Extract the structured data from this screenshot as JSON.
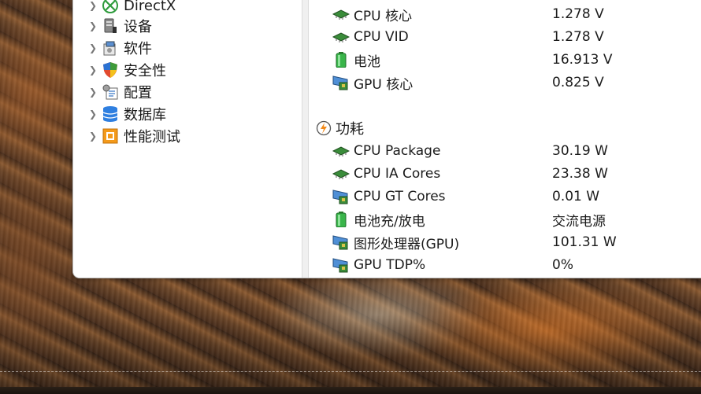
{
  "tree": {
    "items": [
      {
        "label": "DirectX",
        "icon": "xbox-icon"
      },
      {
        "label": "设备",
        "icon": "device-icon"
      },
      {
        "label": "软件",
        "icon": "software-icon"
      },
      {
        "label": "安全性",
        "icon": "security-shield-icon"
      },
      {
        "label": "配置",
        "icon": "config-icon"
      },
      {
        "label": "数据库",
        "icon": "database-icon"
      },
      {
        "label": "性能测试",
        "icon": "benchmark-icon"
      }
    ]
  },
  "voltage": {
    "rows": [
      {
        "label": "CPU 核心",
        "value": "1.278 V",
        "icon": "cpu-chip-icon"
      },
      {
        "label": "CPU VID",
        "value": "1.278 V",
        "icon": "cpu-chip-icon"
      },
      {
        "label": "电池",
        "value": "16.913 V",
        "icon": "battery-icon"
      },
      {
        "label": "GPU 核心",
        "value": "0.825 V",
        "icon": "gpu-card-icon"
      }
    ]
  },
  "power": {
    "title": "功耗",
    "icon": "power-icon",
    "rows": [
      {
        "label": "CPU Package",
        "value": "30.19 W",
        "icon": "cpu-chip-icon"
      },
      {
        "label": "CPU IA Cores",
        "value": "23.38 W",
        "icon": "cpu-chip-icon"
      },
      {
        "label": "CPU GT Cores",
        "value": "0.01 W",
        "icon": "gpu-card-icon"
      },
      {
        "label": "电池充/放电",
        "value": "交流电源",
        "icon": "battery-icon"
      },
      {
        "label": "图形处理器(GPU)",
        "value": "101.31 W",
        "icon": "gpu-card-icon"
      },
      {
        "label": "GPU TDP%",
        "value": "0%",
        "icon": "gpu-card-icon"
      }
    ]
  }
}
